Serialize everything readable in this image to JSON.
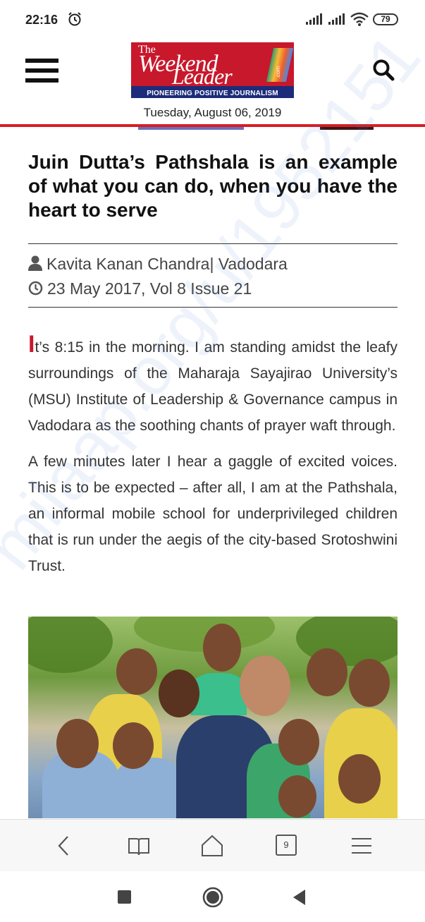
{
  "status_bar": {
    "time": "22:16",
    "battery": "79"
  },
  "header": {
    "logo": {
      "the": "The",
      "word1": "Weekend",
      "word2": "Leader",
      "dotcom": ".com",
      "tagline": "PIONEERING POSITIVE JOURNALISM"
    },
    "date": "Tuesday, August 06, 2019"
  },
  "article": {
    "title": "Juin Dutta’s Pathshala is an example of what you can do, when you have the heart to serve",
    "byline": "Kavita Kanan Chandra| Vadodara",
    "dateline": "23 May 2017, Vol 8 Issue 21",
    "para1_dropcap": "I",
    "para1_rest": "t’s 8:15 in the morning. I am standing amidst the leafy surroundings of the Maharaja Sayajirao University’s (MSU) Institute of Leadership & Governance campus in Vadodara as the soothing chants of prayer waft through.",
    "para2": "A few minutes later I hear a gaggle of excited voices. This is to be expected – after all, I am at the Pathshala, an informal mobile school for underprivileged children that is run under the aegis of the city-based Srotoshwini Trust."
  },
  "browser_bar": {
    "tab_count": "9"
  },
  "watermark": "milaap.org/u/1952151",
  "colors": {
    "accent_red": "#d41e24",
    "logo_blue": "#1c2c7a",
    "dropcap_red": "#c8182c"
  },
  "icons": [
    "alarm-icon",
    "signal-icon",
    "wifi-icon",
    "battery-icon",
    "menu-icon",
    "search-icon",
    "user-icon",
    "clock-icon",
    "back-icon",
    "bookmarks-icon",
    "home-icon",
    "tabs-icon",
    "browser-menu-icon",
    "recents-icon",
    "home-circle-icon",
    "nav-back-icon"
  ]
}
